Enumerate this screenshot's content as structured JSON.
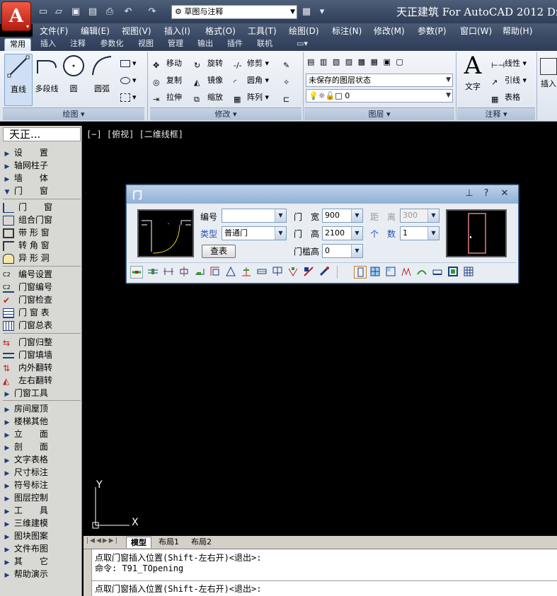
{
  "titlebar": {
    "app_button": "A",
    "workspace": "草图与注释",
    "title": "天正建筑 For AutoCAD 2012  Drav"
  },
  "menu": [
    "文件(F)",
    "编辑(E)",
    "视图(V)",
    "插入(I)",
    "格式(O)",
    "工具(T)",
    "绘图(D)",
    "标注(N)",
    "修改(M)",
    "参数(P)",
    "窗口(W)",
    "帮助(H)"
  ],
  "tabs": [
    "常用",
    "插入",
    "注释",
    "参数化",
    "视图",
    "管理",
    "输出",
    "插件",
    "联机"
  ],
  "ribbon": {
    "draw": {
      "line": "直线",
      "polyline": "多段线",
      "circle": "圆",
      "arc": "圆弧",
      "title": "绘图"
    },
    "modify": {
      "move": "移动",
      "rotate": "旋转",
      "trim": "修剪",
      "copy": "复制",
      "mirror": "镜像",
      "fillet": "圆角",
      "stretch": "拉伸",
      "scale": "缩放",
      "array": "阵列",
      "title": "修改"
    },
    "layers": {
      "state": "未保存的图层状态",
      "current": "0",
      "title": "图层"
    },
    "annotation": {
      "text": "文字",
      "linear": "线性",
      "leader": "引线",
      "table": "表格",
      "title": "注释"
    },
    "insert": "插入"
  },
  "viewport_label": "[−] [俯视] [二维线框]",
  "palette": {
    "title": "天正...",
    "top_items": [
      "设　　置",
      "轴网柱子",
      "墙　　体",
      "门　　窗"
    ],
    "door_tools": [
      "门　　窗",
      "组合门窗",
      "带 形 窗",
      "转 角 窗",
      "异 形 洞"
    ],
    "numbering_tools": [
      "编号设置",
      "门窗编号",
      "门窗检查",
      "门 窗 表",
      "门窗总表"
    ],
    "edit_tools": [
      "门窗归整",
      "门窗填墙",
      "内外翻转",
      "左右翻转",
      "门窗工具"
    ],
    "bottom_items": [
      "房间屋顶",
      "楼梯其他",
      "立　　面",
      "剖　　面",
      "文字表格",
      "尺寸标注",
      "符号标注",
      "图层控制",
      "工　　具",
      "三维建模",
      "图块图案",
      "文件布图",
      "其　　它",
      "帮助演示"
    ]
  },
  "dialog": {
    "title": "门",
    "number_label": "编号",
    "number_value": "",
    "type_label": "类型",
    "type_value": "普通门",
    "query_button": "查表",
    "width_label": "门　宽",
    "width_value": "900",
    "height_label": "门　高",
    "height_value": "2100",
    "sill_label": "门槛高",
    "sill_value": "0",
    "distance_label": "距　离",
    "distance_value": "300",
    "count_label": "个　数",
    "count_value": "1",
    "pin_icon": "pin-icon",
    "help_icon": "?",
    "close_icon": "✕"
  },
  "ucs": {
    "y": "Y",
    "x": "X"
  },
  "layout_tabs": [
    "模型",
    "布局1",
    "布局2"
  ],
  "command": {
    "line1": "点取门窗插入位置(Shift-左右开)<退出>:",
    "line2": "命令: T91_TOpening",
    "line3": "点取门窗插入位置(Shift-左右开)<退出>:"
  },
  "colors": {
    "accent": "#2850b0",
    "canvas": "#000000",
    "door_preview": "#e08080"
  }
}
